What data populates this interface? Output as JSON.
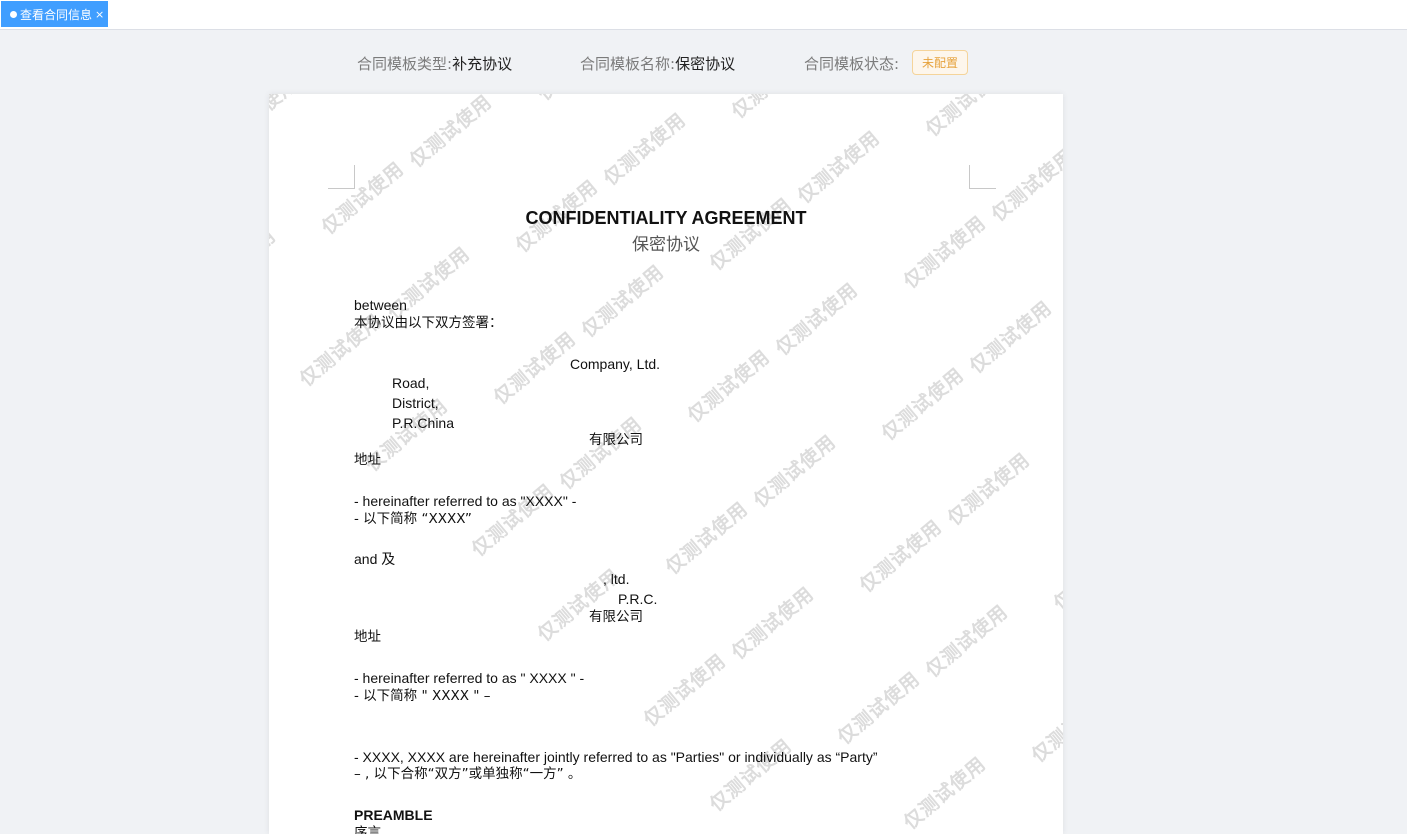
{
  "tab": {
    "label": "查看合同信息",
    "close": "×"
  },
  "info": {
    "type_label": "合同模板类型:",
    "type_value": "补充协议",
    "name_label": "合同模板名称:",
    "name_value": "保密协议",
    "status_label": "合同模板状态:",
    "status_badge": "未配置"
  },
  "document": {
    "title_en": "CONFIDENTIALITY AGREEMENT",
    "title_cn": "保密协议",
    "between": "between",
    "signed_by": "本协议由以下双方签署：",
    "party1": {
      "company": "Company, Ltd.",
      "road": "Road,",
      "district": "District,",
      "country": "P.R.China",
      "company_cn": "有限公司",
      "address_cn": "地址",
      "ref_en": "- hereinafter referred to as \"XXXX\" -",
      "ref_cn": "- 以下简称 “XXXX”"
    },
    "and": "and 及",
    "party2": {
      "company": ", ltd.",
      "country": "P.R.C.",
      "company_cn": "有限公司",
      "address_cn": "地址",
      "ref_en": "- hereinafter referred to as \" XXXX \" -",
      "ref_cn": "- 以下简称 \" XXXX \" –"
    },
    "parties_en": "- XXXX, XXXX are hereinafter jointly referred to as \"Parties\" or individually as “Party”",
    "parties_cn": "–    ,    以下合称“双方”或单独称“一方” 。",
    "preamble": "PREAMBLE",
    "preamble_cn": "序言"
  },
  "watermark": "仅测试使用"
}
